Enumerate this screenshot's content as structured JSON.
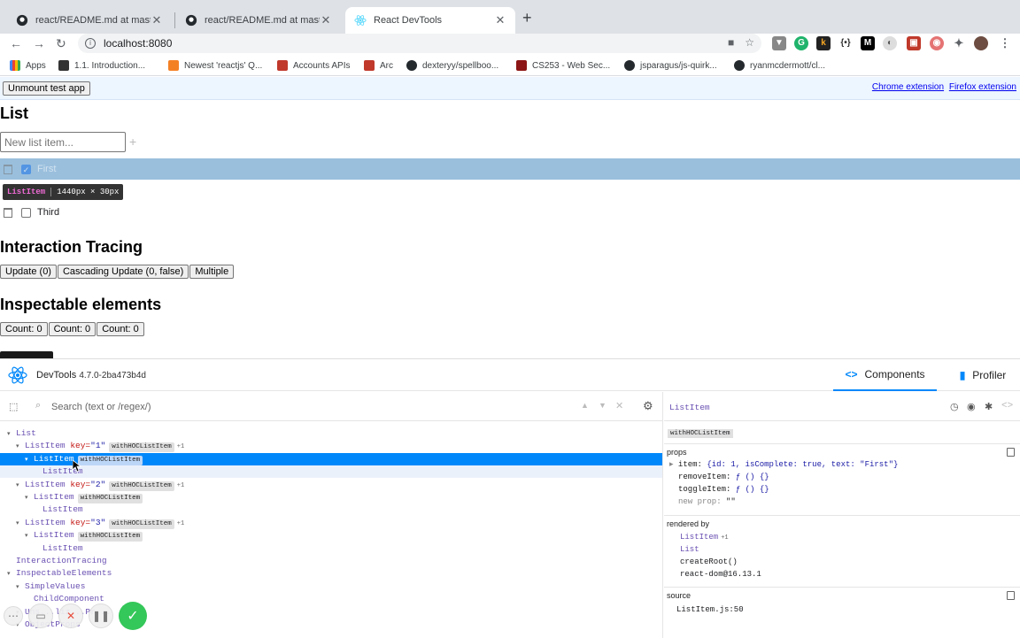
{
  "browser": {
    "tabs": [
      {
        "title": "react/README.md at master · f"
      },
      {
        "title": "react/README.md at master · f"
      },
      {
        "title": "React DevTools"
      }
    ],
    "url": "localhost:8080",
    "bookmarks": [
      "Apps",
      "1.1. Introduction...",
      "Newest 'reactjs' Q...",
      "Accounts APIs",
      "Arc",
      "dexteryy/spellboo...",
      "CS253 - Web Sec...",
      "jsparagus/js-quirk...",
      "ryanmcdermott/cl..."
    ]
  },
  "page": {
    "unmount_label": "Unmount test app",
    "chrome_ext": "Chrome extension",
    "firefox_ext": "Firefox extension",
    "list_heading": "List",
    "new_item_placeholder": "New list item...",
    "plus": "+",
    "items": [
      {
        "text": "First",
        "checked": true
      },
      {
        "text": "Third",
        "checked": false
      }
    ],
    "tooltip_name": "ListItem",
    "tooltip_size": "1440px × 30px",
    "interaction_heading": "Interaction Tracing",
    "interaction_buttons": [
      "Update (0)",
      "Cascading Update (0, false)",
      "Multiple"
    ],
    "inspectable_heading": "Inspectable elements",
    "count_buttons": [
      "Count: 0",
      "Count: 0",
      "Count: 0"
    ]
  },
  "devtools": {
    "title": "DevTools",
    "version": "4.7.0-2ba473b4d",
    "tab_components": "Components",
    "tab_profiler": "Profiler",
    "search_placeholder": "Search (text or /regex/)",
    "tree": [
      {
        "name": "List"
      },
      {
        "name": "ListItem",
        "key": "\"1\"",
        "badge": "withHOCListItem",
        "extra": "+1"
      },
      {
        "name": "ListItem",
        "badge": "withHOCListItem"
      },
      {
        "name": "ListItem"
      },
      {
        "name": "ListItem",
        "key": "\"2\"",
        "badge": "withHOCListItem",
        "extra": "+1"
      },
      {
        "name": "ListItem",
        "badge": "withHOCListItem"
      },
      {
        "name": "ListItem"
      },
      {
        "name": "ListItem",
        "key": "\"3\"",
        "badge": "withHOCListItem",
        "extra": "+1"
      },
      {
        "name": "ListItem",
        "badge": "withHOCListItem"
      },
      {
        "name": "ListItem"
      },
      {
        "name": "InteractionTracing"
      },
      {
        "name": "InspectableElements"
      },
      {
        "name": "SimpleValues"
      },
      {
        "name": "ChildComponent"
      },
      {
        "name": "Uns...liz...Pr..."
      },
      {
        "name": "ObjectProps"
      }
    ],
    "key_label": "key=",
    "selected": {
      "name": "ListItem",
      "badge": "withHOCListItem",
      "props_title": "props",
      "props": [
        {
          "key": "item",
          "value": "{id: 1, isComplete: true, text: \"First\"}"
        },
        {
          "key": "removeItem",
          "value": "ƒ () {}"
        },
        {
          "key": "toggleItem",
          "value": "ƒ () {}"
        }
      ],
      "new_prop_key": "new prop",
      "new_prop_value": "\"\"",
      "rendered_by_title": "rendered by",
      "rendered_by": [
        "ListItem",
        "List",
        "createRoot()",
        "react-dom@16.13.1"
      ],
      "rendered_by_extra": "+1",
      "source_title": "source",
      "source": "ListItem.js:50"
    }
  },
  "colors": {
    "accent": "#0088fa",
    "component": "#6a51b2",
    "key_name": "#c41a16",
    "highlight": "#78aad2"
  }
}
